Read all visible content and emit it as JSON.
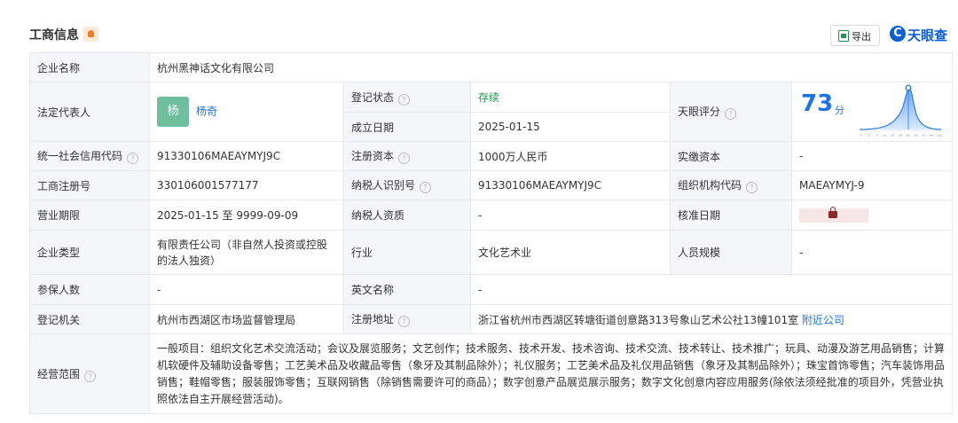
{
  "header": {
    "title": "工商信息",
    "export_label": "导出",
    "logo_text": "天眼查",
    "logo_mark": "C"
  },
  "company_name": {
    "label": "企业名称",
    "value": "杭州黑神话文化有限公司"
  },
  "legal_rep": {
    "label": "法定代表人",
    "avatar_char": "杨",
    "name": "杨奇"
  },
  "reg_status": {
    "label": "登记状态",
    "value": "存续"
  },
  "founded": {
    "label": "成立日期",
    "value": "2025-01-15"
  },
  "score": {
    "label": "天眼评分",
    "value": "73",
    "unit": "分",
    "x_ticks": [
      "0",
      "1",
      "5",
      "10",
      "15",
      "50",
      "65",
      "95",
      "97",
      "99",
      "100"
    ]
  },
  "credit_code": {
    "label": "统一社会信用代码",
    "value": "91330106MAEAYMYJ9C"
  },
  "reg_capital": {
    "label": "注册资本",
    "value": "1000万人民币"
  },
  "paid_capital": {
    "label": "实缴资本",
    "value": "-"
  },
  "reg_number": {
    "label": "工商注册号",
    "value": "330106001577177"
  },
  "taxpayer_id": {
    "label": "纳税人识别号",
    "value": "91330106MAEAYMYJ9C"
  },
  "org_code": {
    "label": "组织机构代码",
    "value": "MAEAYMYJ-9"
  },
  "business_term": {
    "label": "营业期限",
    "value": "2025-01-15 至 9999-09-09"
  },
  "taxpayer_qual": {
    "label": "纳税人资质",
    "value": "-"
  },
  "approval_date": {
    "label": "核准日期"
  },
  "company_type": {
    "label": "企业类型",
    "value": "有限责任公司（非自然人投资或控股的法人独资）"
  },
  "industry": {
    "label": "行业",
    "value": "文化艺术业"
  },
  "staff_size": {
    "label": "人员规模",
    "value": "-"
  },
  "insured": {
    "label": "参保人数",
    "value": "-"
  },
  "english_name": {
    "label": "英文名称",
    "value": "-"
  },
  "reg_authority": {
    "label": "登记机关",
    "value": "杭州市西湖区市场监督管理局"
  },
  "reg_address": {
    "label": "注册地址",
    "value": "浙江省杭州市西湖区转塘街道创意路313号象山艺术公社13幢101室",
    "nearby_link": "附近公司"
  },
  "business_scope": {
    "label": "经营范围",
    "value": "一般项目：组织文化艺术交流活动；会议及展览服务；文艺创作；技术服务、技术开发、技术咨询、技术交流、技术转让、技术推广；玩具、动漫及游艺用品销售；计算机软硬件及辅助设备零售；工艺美术品及收藏品零售（象牙及其制品除外）；礼仪服务；工艺美术品及礼仪用品销售（象牙及其制品除外）；珠宝首饰零售；汽车装饰用品销售；鞋帽零售；服装服饰零售；互联网销售（除销售需要许可的商品）；数字创意产品展览展示服务；数字文化创意内容应用服务(除依法须经批准的项目外，凭营业执照依法自主开展经营活动)。"
  },
  "colors": {
    "accent": "#1a73e8",
    "status": "#1a9b4b",
    "label_bg": "#f4f6fa"
  }
}
